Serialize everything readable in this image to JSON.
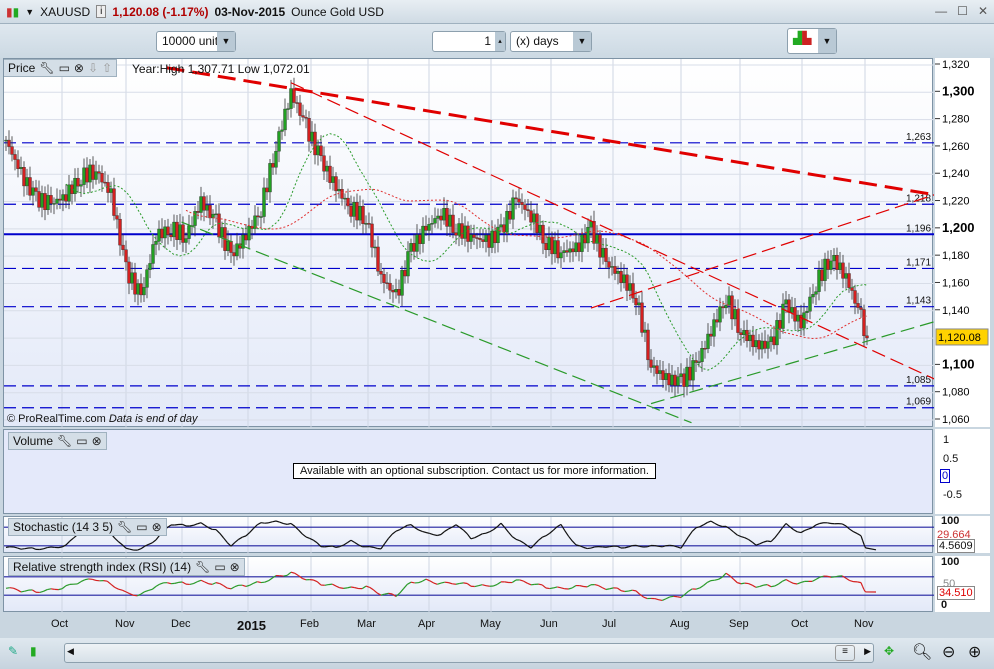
{
  "header": {
    "symbol": "XAUUSD",
    "price_change": "1,120.08 (-1.17%)",
    "date": "03-Nov-2015",
    "description": "Ounce Gold USD"
  },
  "toolbar": {
    "units": "10000 units",
    "period_value": "1",
    "period_unit": "(x) days"
  },
  "price_panel": {
    "label": "Price",
    "year_stats": "Year:High 1,307.71 Low 1,072.01",
    "copyright": "© ProRealTime.com",
    "eod_note": "Data is end of day",
    "current_price": "1,120.08",
    "axis_ticks": [
      "1,320",
      "1,300",
      "1,280",
      "1,260",
      "1,240",
      "1,220",
      "1,200",
      "1,180",
      "1,160",
      "1,140",
      "1,100",
      "1,080",
      "1,060"
    ],
    "levels": [
      {
        "value": 1263,
        "label": "1,263"
      },
      {
        "value": 1218,
        "label": "1,218"
      },
      {
        "value": 1196,
        "label": "1,196",
        "solid": true
      },
      {
        "value": 1171,
        "label": "1,171"
      },
      {
        "value": 1143,
        "label": "1,143"
      },
      {
        "value": 1085,
        "label": "1,085"
      },
      {
        "value": 1069,
        "label": "1,069"
      }
    ]
  },
  "volume_panel": {
    "label": "Volume",
    "message": "Available with an optional subscription. Contact us for more information.",
    "ticks": [
      "1",
      "0.5",
      "0",
      "-0.5"
    ]
  },
  "stochastic_panel": {
    "label": "Stochastic (14 3 5)",
    "tick_top": "100",
    "value1": "29.664",
    "value2": "4.5609"
  },
  "rsi_panel": {
    "label": "Relative strength index (RSI) (14)",
    "tick_top": "100",
    "tick_mid": "50",
    "tick_zero": "0",
    "value": "34.510"
  },
  "x_axis": {
    "labels": [
      "Oct",
      "Nov",
      "Dec",
      "2015",
      "Feb",
      "Mar",
      "Apr",
      "May",
      "Jun",
      "Jul",
      "Aug",
      "Sep",
      "Oct",
      "Nov"
    ]
  },
  "chart_data": {
    "type": "candlestick",
    "ylim": [
      1056,
      1324
    ],
    "x_unit": "weeks from mid-Sep 2014",
    "weekly_close": [
      1265,
      1240,
      1222,
      1218,
      1225,
      1238,
      1243,
      1225,
      1170,
      1150,
      1195,
      1200,
      1195,
      1220,
      1205,
      1180,
      1195,
      1215,
      1260,
      1300,
      1275,
      1250,
      1230,
      1215,
      1208,
      1165,
      1150,
      1185,
      1200,
      1212,
      1200,
      1195,
      1190,
      1198,
      1222,
      1210,
      1190,
      1183,
      1185,
      1200,
      1175,
      1165,
      1150,
      1100,
      1090,
      1088,
      1100,
      1125,
      1150,
      1125,
      1115,
      1115,
      1145,
      1130,
      1160,
      1180,
      1165,
      1135,
      1120.08
    ],
    "trendlines": [
      {
        "from": [
          10.7,
          1318
        ],
        "to": [
          61.9,
          1225
        ],
        "color": "#e00000",
        "style": "thick-dash"
      },
      {
        "from": [
          19,
          1307
        ],
        "to": [
          61.9,
          1090
        ],
        "color": "#e00000",
        "style": "dash"
      },
      {
        "from": [
          11.7,
          1205
        ],
        "to": [
          45.7,
          1058
        ],
        "color": "#2a9a2a",
        "style": "dash"
      },
      {
        "from": [
          43,
          1072
        ],
        "to": [
          61.9,
          1132
        ],
        "color": "#2a9a2a",
        "style": "dash"
      },
      {
        "from": [
          39,
          1142
        ],
        "to": [
          61.9,
          1225
        ],
        "color": "#e00000",
        "style": "dash"
      }
    ],
    "stochastic": [
      15,
      12,
      10,
      14,
      20,
      70,
      85,
      60,
      10,
      8,
      40,
      90,
      85,
      92,
      70,
      20,
      55,
      95,
      98,
      90,
      50,
      20,
      15,
      35,
      15,
      12,
      70,
      88,
      60,
      55,
      90,
      45,
      60,
      90,
      40,
      15,
      55,
      88,
      20,
      12,
      18,
      15,
      20,
      18,
      20,
      15,
      80,
      98,
      80,
      50,
      25,
      35,
      90,
      60,
      88,
      95,
      85,
      50,
      4.56
    ],
    "rsi": [
      45,
      40,
      38,
      42,
      48,
      60,
      65,
      55,
      35,
      30,
      50,
      58,
      55,
      60,
      55,
      45,
      52,
      58,
      70,
      78,
      65,
      55,
      50,
      45,
      48,
      32,
      30,
      58,
      62,
      55,
      56,
      52,
      50,
      56,
      62,
      55,
      48,
      45,
      48,
      52,
      45,
      42,
      38,
      20,
      22,
      28,
      45,
      60,
      75,
      55,
      50,
      50,
      62,
      55,
      65,
      72,
      68,
      55,
      34.51
    ]
  },
  "colors": {
    "up": "#22a022",
    "down": "#d42020",
    "level": "#0000cc",
    "accent": "#ffd200"
  }
}
